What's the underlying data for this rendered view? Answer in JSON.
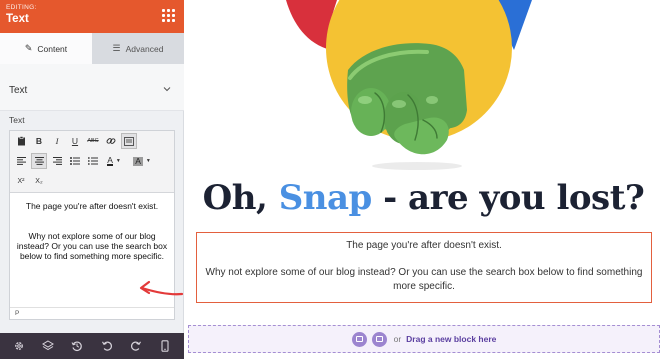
{
  "editor": {
    "editing_label": "EDITING:",
    "title": "Text",
    "accent_color": "#e5582d"
  },
  "tabs": [
    {
      "label": "Content",
      "icon": "pencil-icon",
      "active": true
    },
    {
      "label": "Advanced",
      "icon": "sliders-icon",
      "active": false
    }
  ],
  "section": {
    "title": "Text",
    "field_label": "Text"
  },
  "rte": {
    "toolbar_row1": [
      "clipboard-icon",
      "bold-icon",
      "italic-icon",
      "underline-icon",
      "strikethrough-icon",
      "link-icon",
      "source-code-icon"
    ],
    "toolbar_row2": [
      "align-left-icon",
      "align-center-icon",
      "align-right-icon",
      "bullet-list-icon",
      "numbered-list-icon",
      "text-color-icon",
      "background-color-icon"
    ],
    "toolbar_row3": [
      "superscript-icon",
      "subscript-icon"
    ],
    "labels": {
      "bold": "B",
      "italic": "I",
      "underline": "U",
      "strike": "ABC",
      "text_color": "A",
      "bg_color": "A",
      "superscript": "X²",
      "subscript": "X₂"
    },
    "paragraph1": "The page you're after doesn't exist.",
    "paragraph2": "Why not explore some of our blog instead? Or you can use the search box below to find something more specific.",
    "footer": "P"
  },
  "bottom_bar": [
    "settings-icon",
    "layers-icon",
    "history-icon",
    "undo-icon",
    "redo-icon",
    "mobile-preview-icon"
  ],
  "canvas": {
    "heading_before": "Oh, ",
    "heading_highlight": "Snap",
    "heading_after": " - are you lost?",
    "text_line1": "The page you're after doesn't exist.",
    "text_line2": "Why not explore some of our blog instead? Or you can use the search box below to find something more specific.",
    "drop_or": "or",
    "drop_label": "Drag a new block here",
    "highlight_color": "#4a90e2",
    "selection_color": "#e3603e"
  }
}
